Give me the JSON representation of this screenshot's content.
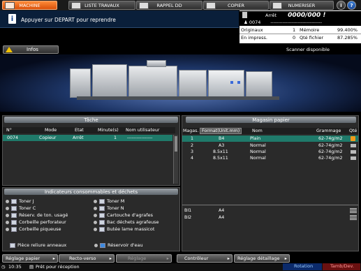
{
  "tabs": [
    {
      "label": "MACHINE",
      "active": true
    },
    {
      "label": "LISTE TRAVAUX",
      "active": false
    },
    {
      "label": "RAPPEL DD",
      "active": false
    },
    {
      "label": "COPIER",
      "active": false
    },
    {
      "label": "NUMERISER",
      "active": false
    }
  ],
  "round_buttons": [
    "i",
    "?",
    "⏻"
  ],
  "message": "Appuyer sur DEPART pour reprendre",
  "status": {
    "state": "Arrêt",
    "counter": "0000/000 !",
    "job_id": "0074",
    "job_dashes": "----------------------------------",
    "originals_label": "Originaux",
    "originals_value": "1",
    "memory_label": "Mémoire",
    "memory_value": "99.400%",
    "in_print_label": "En impress.",
    "in_print_value": "0",
    "file_qty_label": "Qté fichier",
    "file_qty_value": "87.285%"
  },
  "info_button": "Infos",
  "scanner_status": "Scanner disponible",
  "task_panel": {
    "title": "Tâche",
    "columns": [
      "N°",
      "Mode",
      "Etat",
      "Minute(s)",
      "Nom utilisateur"
    ],
    "rows": [
      {
        "no": "0074",
        "mode": "Copieur",
        "state": "Arrêt",
        "minutes": "1",
        "user": "----------------"
      }
    ]
  },
  "paper_panel": {
    "title": "Magasin papier",
    "columns": [
      "Magas.",
      "Format(Unit.mm)",
      "Nom",
      "Grammage",
      "Qté"
    ],
    "rows": [
      {
        "tray": "1",
        "format": "B4",
        "name": "Plain",
        "weight": "62-74g/m2",
        "selected": true
      },
      {
        "tray": "2",
        "format": "A3",
        "name": "Normal",
        "weight": "62-74g/m2",
        "selected": false
      },
      {
        "tray": "3",
        "format": "8.5x11",
        "name": "Normal",
        "weight": "62-74g/m2",
        "selected": false
      },
      {
        "tray": "4",
        "format": "8.5x11",
        "name": "Normal",
        "weight": "62-74g/m2",
        "selected": false
      }
    ],
    "bypass": [
      {
        "tray": "BI1",
        "format": "A4"
      },
      {
        "tray": "BI2",
        "format": "A4"
      }
    ]
  },
  "consumables": {
    "title": "Indicateurs consommables et déchets",
    "left": [
      "Toner J",
      "Toner C",
      "Réserv. de ton. usagé",
      "Corbeille perforateur",
      "Corbeille piqueuse"
    ],
    "right": [
      "Toner M",
      "Toner N",
      "Cartouche d'agrafes",
      "Bac déchets agrafeuse",
      "Butée lame massicot"
    ],
    "bottom_left": "Pièce reliure anneaux",
    "bottom_right": "Réservoir d'eau"
  },
  "bottom_buttons": [
    "Réglage papier",
    "Recto-verso",
    "Réglage",
    "Contrôleur",
    "Réglage détaillage"
  ],
  "statusbar": {
    "time": "10:35",
    "print_ready": "Prêt pour réception",
    "rotation": "Rotation",
    "toner": "Tamb/Dev."
  }
}
